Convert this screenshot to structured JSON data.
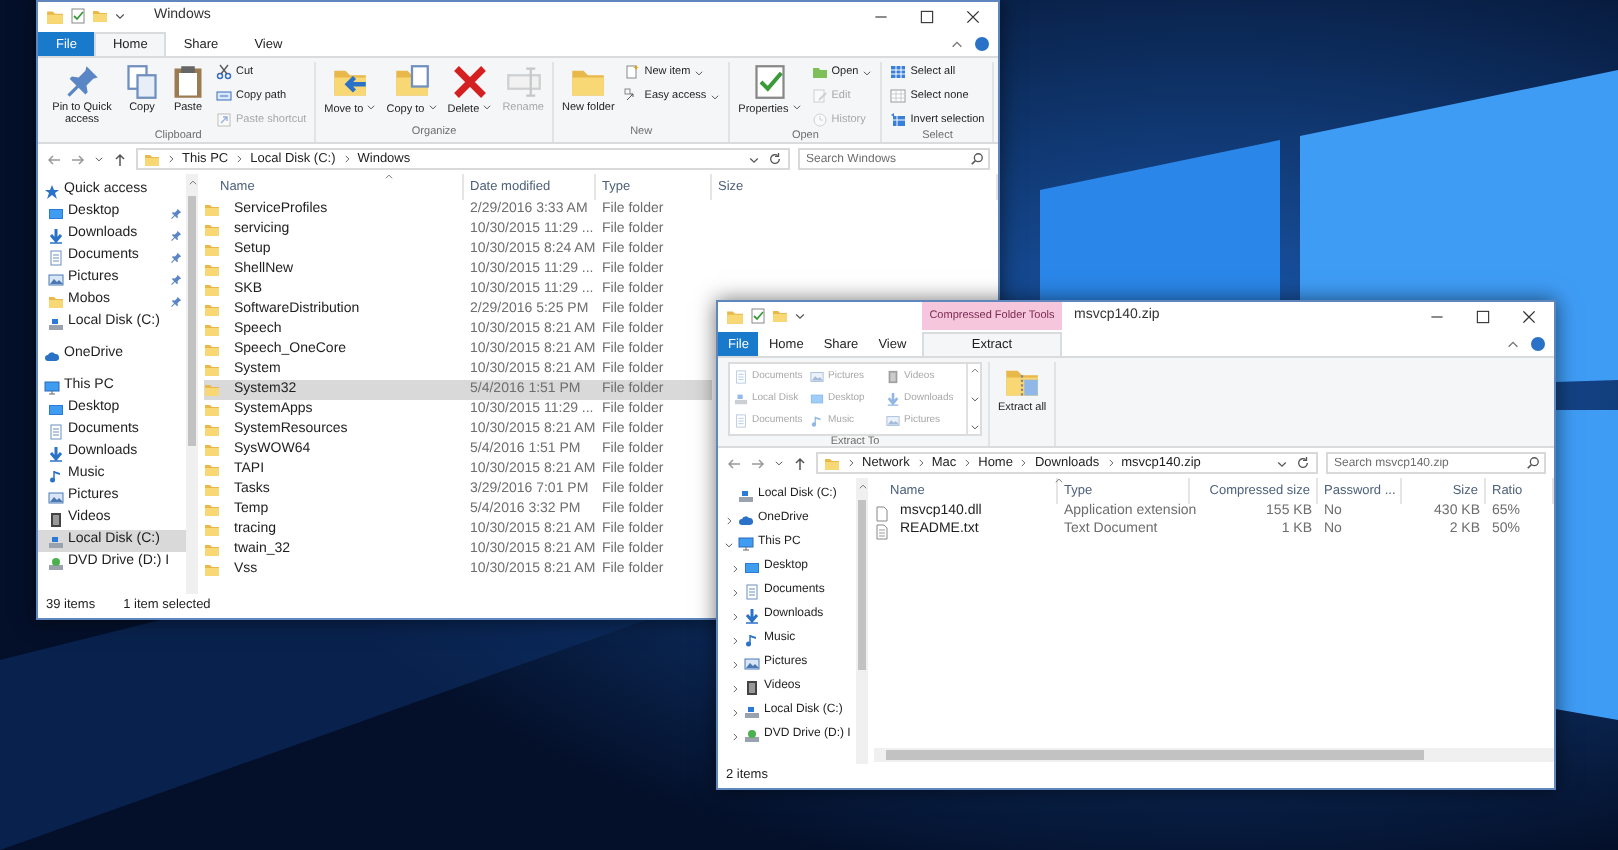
{
  "windows": [
    {
      "kind": "explorer",
      "title": "Windows",
      "tabs": [
        {
          "label": "File",
          "kind": "file",
          "selected": false
        },
        {
          "label": "Home",
          "kind": "plain",
          "selected": true
        },
        {
          "label": "Share",
          "kind": "plain",
          "selected": false
        },
        {
          "label": "View",
          "kind": "plain",
          "selected": false
        }
      ],
      "ribbon": [
        {
          "label": "Clipboard",
          "items": [
            {
              "kind": "large",
              "label": "Pin to Quick access",
              "dropdown": false,
              "disabled": false
            },
            {
              "kind": "large",
              "label": "Copy",
              "dropdown": false,
              "disabled": false
            },
            {
              "kind": "large",
              "label": "Paste",
              "dropdown": false,
              "disabled": false
            },
            {
              "kind": "small",
              "label": "Cut",
              "dropdown": false,
              "disabled": false
            },
            {
              "kind": "small",
              "label": "Copy path",
              "dropdown": false,
              "disabled": false
            },
            {
              "kind": "small",
              "label": "Paste shortcut",
              "dropdown": false,
              "disabled": true
            }
          ]
        },
        {
          "label": "Organize",
          "items": [
            {
              "kind": "large",
              "label": "Move to",
              "dropdown": true,
              "disabled": false
            },
            {
              "kind": "large",
              "label": "Copy to",
              "dropdown": true,
              "disabled": false
            },
            {
              "kind": "large",
              "label": "Delete",
              "dropdown": true,
              "disabled": false
            },
            {
              "kind": "large",
              "label": "Rename",
              "dropdown": false,
              "disabled": true
            }
          ]
        },
        {
          "label": "New",
          "items": [
            {
              "kind": "large",
              "label": "New folder",
              "dropdown": false,
              "disabled": false
            },
            {
              "kind": "small",
              "label": "New item",
              "dropdown": true,
              "disabled": false
            },
            {
              "kind": "small",
              "label": "Easy access",
              "dropdown": true,
              "disabled": false
            }
          ]
        },
        {
          "label": "Open",
          "items": [
            {
              "kind": "large",
              "label": "Properties",
              "dropdown": true,
              "disabled": false
            },
            {
              "kind": "small",
              "label": "Open",
              "dropdown": true,
              "disabled": false
            },
            {
              "kind": "small",
              "label": "Edit",
              "dropdown": false,
              "disabled": true
            },
            {
              "kind": "small",
              "label": "History",
              "dropdown": false,
              "disabled": true
            }
          ]
        },
        {
          "label": "Select",
          "items": [
            {
              "kind": "small",
              "label": "Select all",
              "dropdown": false,
              "disabled": false
            },
            {
              "kind": "small",
              "label": "Select none",
              "dropdown": false,
              "disabled": false
            },
            {
              "kind": "small",
              "label": "Invert selection",
              "dropdown": false,
              "disabled": false
            }
          ]
        }
      ],
      "address": {
        "crumbs": [
          "This PC",
          "Local Disk (C:)",
          "Windows"
        ]
      },
      "search": {
        "placeholder": "Search Windows"
      },
      "nav": [
        {
          "label": "Quick access",
          "selected": false,
          "children": [
            {
              "label": "Desktop",
              "selected": false,
              "pinned": true
            },
            {
              "label": "Downloads",
              "selected": false,
              "pinned": true
            },
            {
              "label": "Documents",
              "selected": false,
              "pinned": true
            },
            {
              "label": "Pictures",
              "selected": false,
              "pinned": true
            },
            {
              "label": "Mobos",
              "selected": false,
              "pinned": true
            },
            {
              "label": "Local Disk (C:)",
              "selected": false,
              "pinned": false
            }
          ]
        },
        {
          "label": "OneDrive",
          "selected": false
        },
        {
          "label": "This PC",
          "selected": false,
          "children": [
            {
              "label": "Desktop",
              "selected": false
            },
            {
              "label": "Documents",
              "selected": false
            },
            {
              "label": "Downloads",
              "selected": false
            },
            {
              "label": "Music",
              "selected": false
            },
            {
              "label": "Pictures",
              "selected": false
            },
            {
              "label": "Videos",
              "selected": false
            },
            {
              "label": "Local Disk (C:)",
              "selected": true
            },
            {
              "label": "DVD Drive (D:) I",
              "selected": false
            }
          ]
        }
      ],
      "columns": [
        "Name",
        "Date modified",
        "Type",
        "Size"
      ],
      "rows": [
        {
          "cells": [
            "ServiceProfiles",
            "2/29/2016 3:33 AM",
            "File folder"
          ],
          "selected": false
        },
        {
          "cells": [
            "servicing",
            "10/30/2015 11:29 ...",
            "File folder"
          ],
          "selected": false
        },
        {
          "cells": [
            "Setup",
            "10/30/2015 8:24 AM",
            "File folder"
          ],
          "selected": false
        },
        {
          "cells": [
            "ShellNew",
            "10/30/2015 11:29 ...",
            "File folder"
          ],
          "selected": false
        },
        {
          "cells": [
            "SKB",
            "10/30/2015 11:29 ...",
            "File folder"
          ],
          "selected": false
        },
        {
          "cells": [
            "SoftwareDistribution",
            "2/29/2016 5:25 PM",
            "File folder"
          ],
          "selected": false
        },
        {
          "cells": [
            "Speech",
            "10/30/2015 8:21 AM",
            "File folder"
          ],
          "selected": false
        },
        {
          "cells": [
            "Speech_OneCore",
            "10/30/2015 8:21 AM",
            "File folder"
          ],
          "selected": false
        },
        {
          "cells": [
            "System",
            "10/30/2015 8:21 AM",
            "File folder"
          ],
          "selected": false
        },
        {
          "cells": [
            "System32",
            "5/4/2016 1:51 PM",
            "File folder"
          ],
          "selected": true
        },
        {
          "cells": [
            "SystemApps",
            "10/30/2015 11:29 ...",
            "File folder"
          ],
          "selected": false
        },
        {
          "cells": [
            "SystemResources",
            "10/30/2015 8:21 AM",
            "File folder"
          ],
          "selected": false
        },
        {
          "cells": [
            "SysWOW64",
            "5/4/2016 1:51 PM",
            "File folder"
          ],
          "selected": false
        },
        {
          "cells": [
            "TAPI",
            "10/30/2015 8:21 AM",
            "File folder"
          ],
          "selected": false
        },
        {
          "cells": [
            "Tasks",
            "3/29/2016 7:01 PM",
            "File folder"
          ],
          "selected": false
        },
        {
          "cells": [
            "Temp",
            "5/4/2016 3:32 PM",
            "File folder"
          ],
          "selected": false
        },
        {
          "cells": [
            "tracing",
            "10/30/2015 8:21 AM",
            "File folder"
          ],
          "selected": false
        },
        {
          "cells": [
            "twain_32",
            "10/30/2015 8:21 AM",
            "File folder"
          ],
          "selected": false
        },
        {
          "cells": [
            "Vss",
            "10/30/2015 8:21 AM",
            "File folder"
          ],
          "selected": false
        }
      ],
      "status": [
        "39 items",
        "1 item selected"
      ]
    },
    {
      "kind": "zip",
      "title": "msvcp140.zip",
      "context_label": "Compressed Folder Tools",
      "tabs": [
        {
          "label": "File",
          "kind": "file",
          "selected": false
        },
        {
          "label": "Home",
          "kind": "plain",
          "selected": false
        },
        {
          "label": "Share",
          "kind": "plain",
          "selected": false
        },
        {
          "label": "View",
          "kind": "plain",
          "selected": false
        },
        {
          "label": "Extract",
          "kind": "context",
          "selected": true
        }
      ],
      "ribbon": [
        {
          "label": "Extract To",
          "items": [
            {
              "kind": "location",
              "label": "Documents",
              "dropdown": false,
              "disabled": true
            },
            {
              "kind": "location",
              "label": "Local Disk",
              "dropdown": false,
              "disabled": true
            },
            {
              "kind": "location",
              "label": "Documents",
              "dropdown": false,
              "disabled": true
            },
            {
              "kind": "location",
              "label": "Pictures",
              "dropdown": false,
              "disabled": true
            },
            {
              "kind": "location",
              "label": "Desktop",
              "dropdown": false,
              "disabled": true
            },
            {
              "kind": "location",
              "label": "Music",
              "dropdown": false,
              "disabled": true
            },
            {
              "kind": "location",
              "label": "Videos",
              "dropdown": false,
              "disabled": true
            },
            {
              "kind": "location",
              "label": "Downloads",
              "dropdown": false,
              "disabled": true
            },
            {
              "kind": "location",
              "label": "Pictures",
              "dropdown": false,
              "disabled": true
            }
          ]
        },
        {
          "items": [
            {
              "kind": "large",
              "label": "Extract all",
              "dropdown": false,
              "disabled": false
            }
          ]
        }
      ],
      "address": {
        "crumbs": [
          "Network",
          "Mac",
          "Home",
          "Downloads",
          "msvcp140.zip"
        ]
      },
      "search": {
        "placeholder": "Search msvcp140.zip"
      },
      "nav": [
        {
          "label": "Local Disk (C:)",
          "selected": false
        },
        {
          "label": "OneDrive",
          "selected": false,
          "expanded": false
        },
        {
          "label": "This PC",
          "selected": false,
          "expanded": true,
          "children": [
            {
              "label": "Desktop",
              "selected": false,
              "expanded": false
            },
            {
              "label": "Documents",
              "selected": false,
              "expanded": false
            },
            {
              "label": "Downloads",
              "selected": false,
              "expanded": false
            },
            {
              "label": "Music",
              "selected": false,
              "expanded": false
            },
            {
              "label": "Pictures",
              "selected": false,
              "expanded": false
            },
            {
              "label": "Videos",
              "selected": false,
              "expanded": false
            },
            {
              "label": "Local Disk (C:)",
              "selected": false,
              "expanded": false
            },
            {
              "label": "DVD Drive (D:) I",
              "selected": false,
              "expanded": false
            }
          ]
        }
      ],
      "columns": [
        "Name",
        "Type",
        "Compressed size",
        "Password ...",
        "Size",
        "Ratio"
      ],
      "rows": [
        {
          "cells": [
            "msvcp140.dll",
            "Application extension",
            "155 KB",
            "No",
            "430 KB",
            "65%"
          ],
          "selected": false
        },
        {
          "cells": [
            "README.txt",
            "Text Document",
            "1 KB",
            "No",
            "2 KB",
            "50%"
          ],
          "selected": false
        }
      ],
      "status": [
        "2 items"
      ]
    }
  ]
}
